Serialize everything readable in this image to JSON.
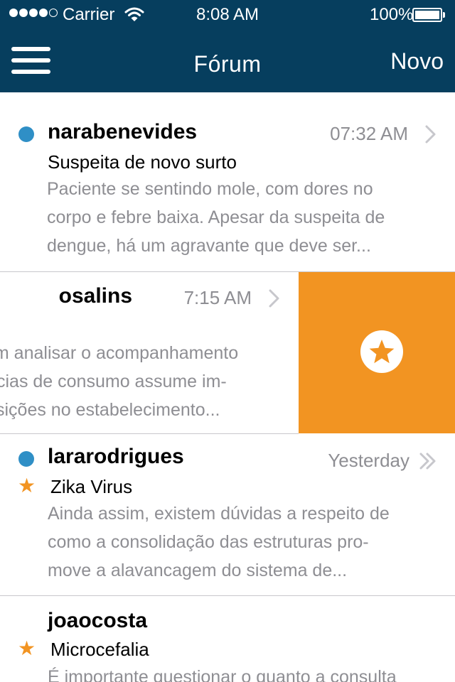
{
  "status_bar": {
    "carrier": "Carrier",
    "time": "8:08 AM",
    "battery": "100%"
  },
  "nav": {
    "title": "Fórum",
    "new_label": "Novo",
    "menu_icon": "hamburger-menu-icon"
  },
  "colors": {
    "header_bg": "#063e5e",
    "accent_orange": "#f29422",
    "unread_blue": "#2f8fc6",
    "secondary_text": "#8e8e93"
  },
  "posts": [
    {
      "sender": "narabenevides",
      "time": "07:32 AM",
      "subject": "Suspeita de novo surto",
      "preview_lines": [
        "Paciente se sentindo mole, com dores no",
        "corpo e febre baixa. Apesar da suspeita de",
        "dengue, há um agravante que deve ser..."
      ],
      "unread": true,
      "starred": false
    },
    {
      "sender": "osalins",
      "time": "7:15 AM",
      "subject": "",
      "preview_lines": [
        "em analisar o acompanhamento",
        "cias de consumo assume im-",
        "sições no estabelecimento..."
      ],
      "unread": false,
      "starred": false,
      "swipe_action_icon": "star-circle-icon"
    },
    {
      "sender": "lararodrigues",
      "time": "Yesterday",
      "subject": "Zika Virus",
      "preview_lines": [
        "Ainda assim, existem dúvidas a respeito de",
        "como a consolidação das estruturas pro-",
        "move a alavancagem do sistema de..."
      ],
      "unread": true,
      "starred": true
    },
    {
      "sender": "joaocosta",
      "time": "",
      "subject": "Microcefalia",
      "preview_lines": [
        "É importante questionar o quanto a consulta"
      ],
      "unread": false,
      "starred": true
    }
  ]
}
